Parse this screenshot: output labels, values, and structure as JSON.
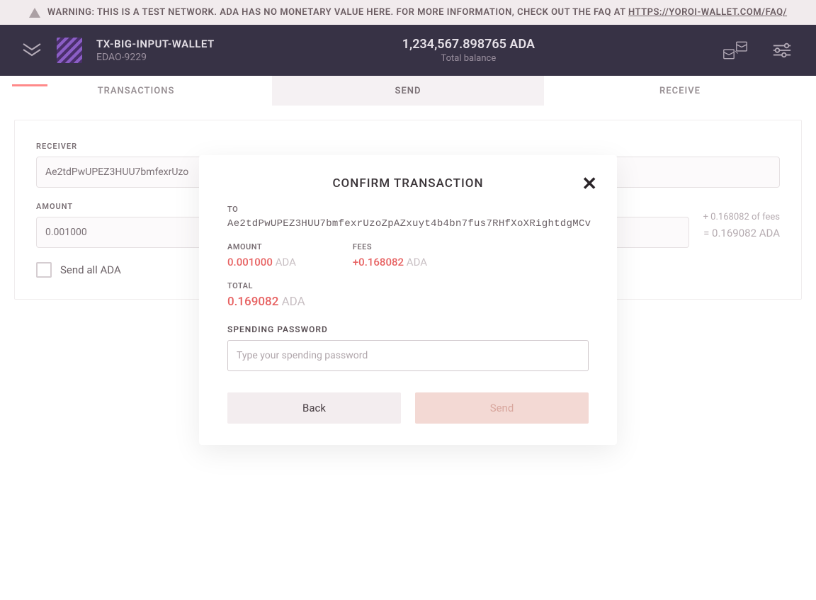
{
  "warning": {
    "text": "WARNING: THIS IS A TEST NETWORK. ADA HAS NO MONETARY VALUE HERE. FOR MORE INFORMATION, CHECK OUT THE FAQ AT ",
    "link": "HTTPS://YOROI-WALLET.COM/FAQ/"
  },
  "header": {
    "walletName": "TX-BIG-INPUT-WALLET",
    "walletCode": "EDAO-9229",
    "balance": "1,234,567.898765 ADA",
    "balanceLabel": "Total balance"
  },
  "tabs": {
    "transactions": "TRANSACTIONS",
    "send": "SEND",
    "receive": "RECEIVE"
  },
  "form": {
    "receiverLabel": "RECEIVER",
    "receiverValue": "Ae2tdPwUPEZ3HUU7bmfexrUzo",
    "amountLabel": "AMOUNT",
    "amountValue": "0.001000",
    "feesText": "+ 0.168082 of fees",
    "equalsText": "= 0.169082 ADA",
    "sendAllLabel": "Send all ADA"
  },
  "modal": {
    "title": "CONFIRM TRANSACTION",
    "toLabel": "TO",
    "toValue": "Ae2tdPwUPEZ3HUU7bmfexrUzoZpAZxuyt4b4bn7fus7RHfXoXRightdgMCv",
    "amountLabel": "AMOUNT",
    "amountNum": "0.001000",
    "amountCur": "ADA",
    "feesLabel": "FEES",
    "feesNum": "+0.168082",
    "feesCur": "ADA",
    "totalLabel": "TOTAL",
    "totalNum": "0.169082",
    "totalCur": "ADA",
    "passwordLabel": "SPENDING PASSWORD",
    "passwordPlaceholder": "Type your spending password",
    "backLabel": "Back",
    "sendLabel": "Send"
  }
}
